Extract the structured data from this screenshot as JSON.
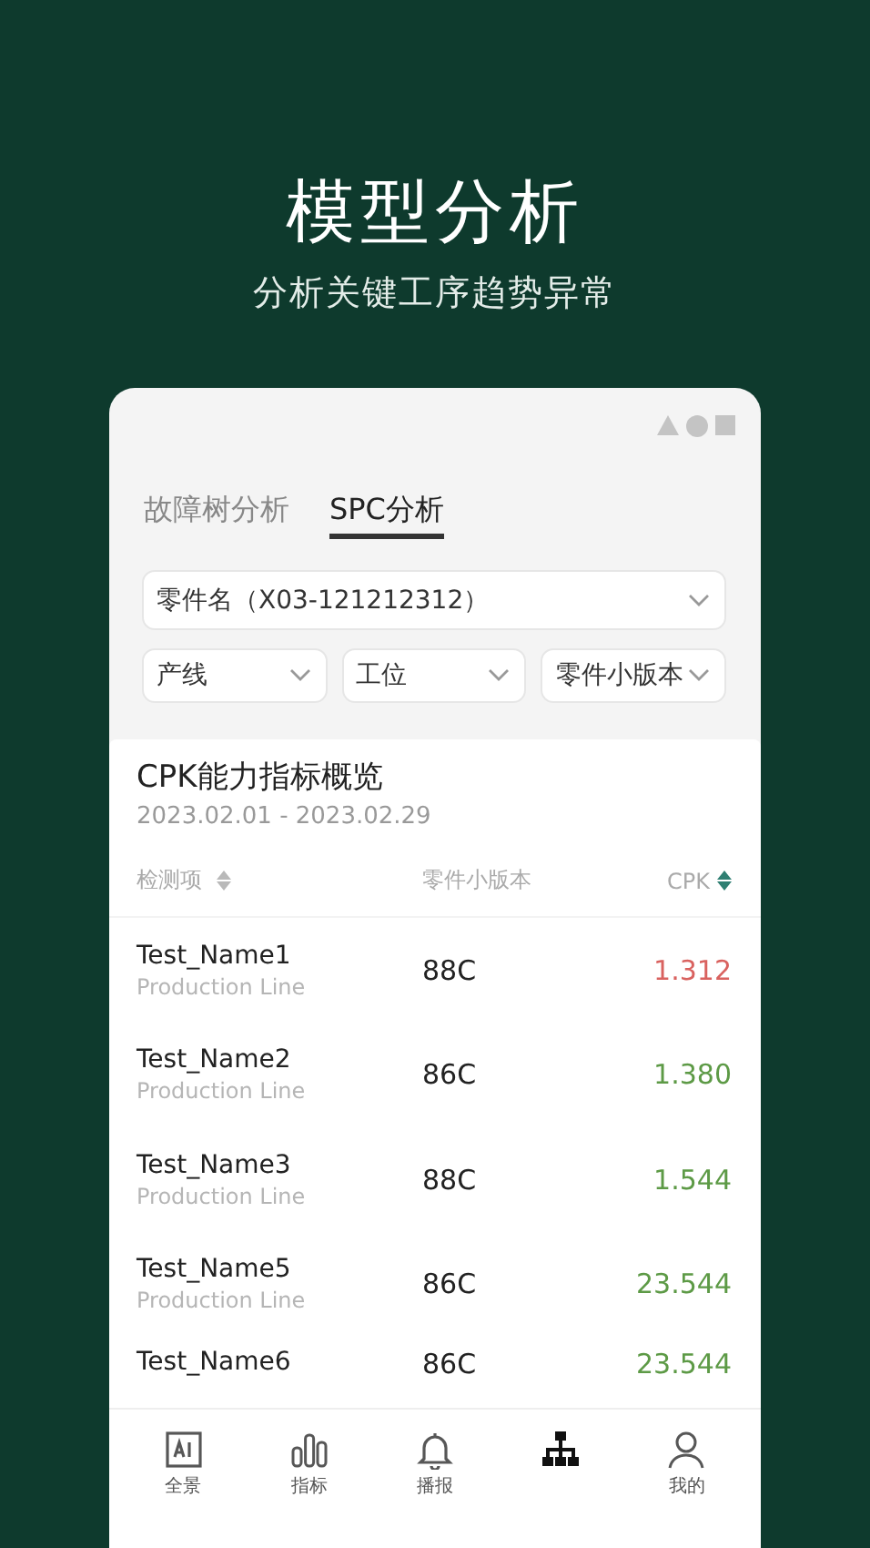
{
  "header": {
    "title": "模型分析",
    "subtitle": "分析关键工序趋势异常"
  },
  "tabs": [
    {
      "label": "故障树分析",
      "selected": false
    },
    {
      "label": "SPC分析",
      "selected": true
    }
  ],
  "part_select": {
    "value": "零件名（X03-121212312）"
  },
  "filters": [
    {
      "label": "产线"
    },
    {
      "label": "工位"
    },
    {
      "label": "零件小版本"
    }
  ],
  "overview": {
    "title": "CPK能力指标概览",
    "date_range": "2023.02.01 - 2023.02.29"
  },
  "columns": [
    {
      "label": "检测项",
      "sorted": false
    },
    {
      "label": "零件小版本"
    },
    {
      "label": "CPK",
      "sorted": true
    }
  ],
  "rows": [
    {
      "name": "Test_Name1",
      "line": "Production Line",
      "version": "88C",
      "cpk": "1.312",
      "color": "#d9625f"
    },
    {
      "name": "Test_Name2",
      "line": "Production Line",
      "version": "86C",
      "cpk": "1.380",
      "color": "#5d9a46"
    },
    {
      "name": "Test_Name3",
      "line": "Production Line",
      "version": "88C",
      "cpk": "1.544",
      "color": "#5d9a46"
    },
    {
      "name": "Test_Name5",
      "line": "Production Line",
      "version": "86C",
      "cpk": "23.544",
      "color": "#5d9a46"
    },
    {
      "name": "Test_Name6",
      "version": "86C",
      "cpk": "23.544",
      "color": "#5d9a46"
    }
  ],
  "nav": [
    {
      "kind": "ai",
      "label": "全景",
      "selected": false
    },
    {
      "kind": "bars",
      "label": "指标",
      "selected": false
    },
    {
      "kind": "bell",
      "label": "播报",
      "selected": false
    },
    {
      "kind": "network",
      "selected": true
    },
    {
      "kind": "person",
      "label": "我的",
      "selected": false
    }
  ]
}
